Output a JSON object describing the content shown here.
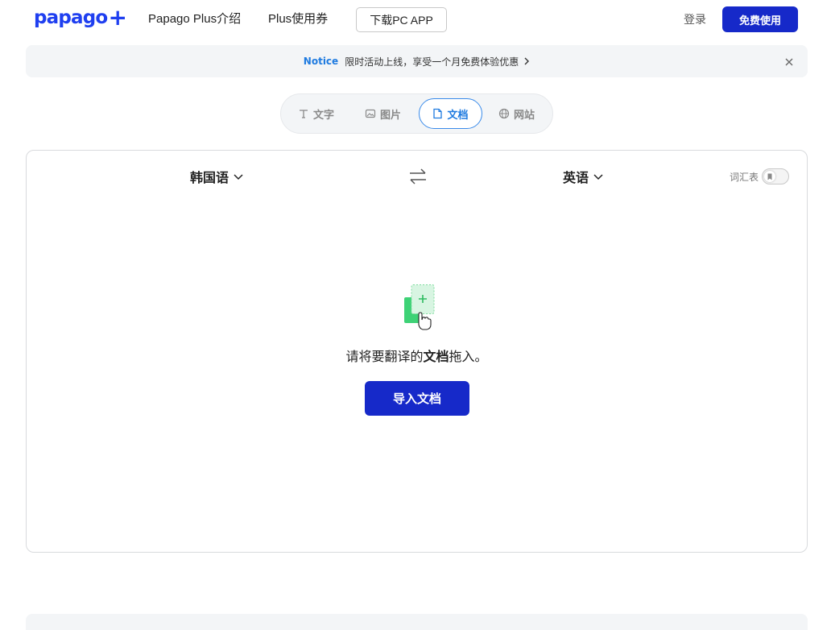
{
  "header": {
    "logo_text": "papago",
    "logo_plus": "+",
    "nav_intro": "Papago Plus介绍",
    "nav_coupon": "Plus使用券",
    "download_label": "下载PC APP",
    "login_label": "登录",
    "free_label": "免费使用"
  },
  "notice": {
    "tag": "Notice",
    "text": "限时活动上线，享受一个月免费体验优惠",
    "close_icon": "close-icon"
  },
  "tabs": [
    {
      "label": "文字",
      "icon": "text-icon"
    },
    {
      "label": "图片",
      "icon": "image-icon"
    },
    {
      "label": "文档",
      "icon": "document-icon",
      "active": true
    },
    {
      "label": "网站",
      "icon": "globe-icon"
    }
  ],
  "panel": {
    "source_lang": "韩国语",
    "target_lang": "英语",
    "glossary_label": "词汇表",
    "glossary_on": false,
    "drop_prefix": "请将要翻译的",
    "drop_bold": "文档",
    "drop_suffix": "拖入。",
    "import_label": "导入文档"
  },
  "colors": {
    "brand": "#1f3ff0",
    "button": "#1629c9",
    "accent": "#1f7be0",
    "doc_green": "#3ed276"
  }
}
